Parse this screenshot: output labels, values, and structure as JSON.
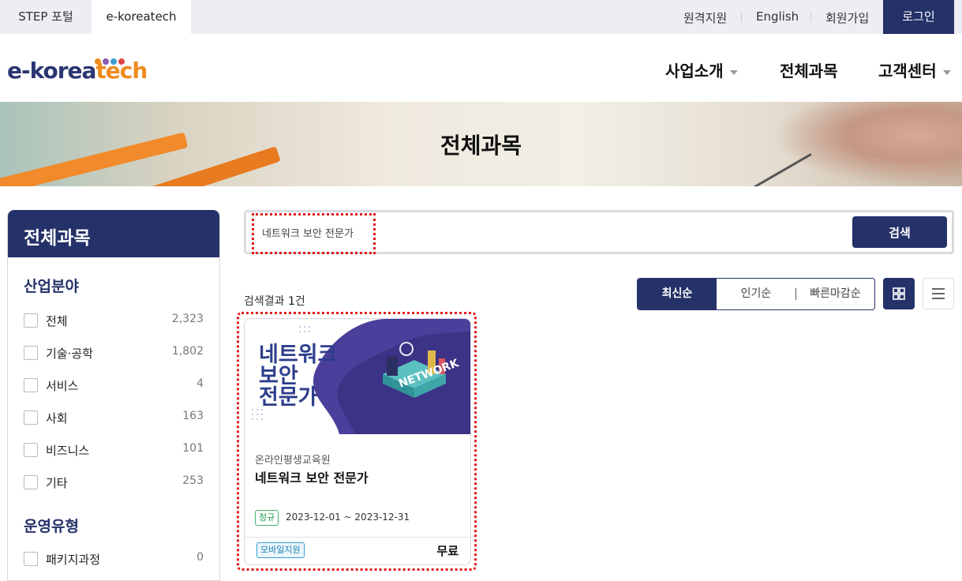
{
  "topbar": {
    "tabs": [
      "STEP 포털",
      "e-koreatech"
    ],
    "links": [
      "원격지원",
      "English",
      "회원가입"
    ],
    "login": "로그인"
  },
  "header": {
    "logo_part1": "e-korea",
    "logo_part2": "tech",
    "nav": [
      "사업소개",
      "전체과목",
      "고객센터"
    ]
  },
  "banner": {
    "title": "전체과목"
  },
  "sidebar": {
    "title": "전체과목",
    "section1": "산업분야",
    "industry": [
      {
        "label": "전체",
        "count": "2,323"
      },
      {
        "label": "기술·공학",
        "count": "1,802"
      },
      {
        "label": "서비스",
        "count": "4"
      },
      {
        "label": "사회",
        "count": "163"
      },
      {
        "label": "비즈니스",
        "count": "101"
      },
      {
        "label": "기타",
        "count": "253"
      }
    ],
    "section2": "운영유형",
    "operation": [
      {
        "label": "패키지과정",
        "count": "0"
      }
    ]
  },
  "search": {
    "value": "네트워크 보안 전문가",
    "button": "검색"
  },
  "results": {
    "prefix": "검색결과 ",
    "count": "1",
    "suffix": "건"
  },
  "sort": {
    "options": [
      "최신순",
      "인기순",
      "빠른마감순"
    ],
    "active": "최신순"
  },
  "card": {
    "thumb_line1": "네트워크",
    "thumb_line2": "보안",
    "thumb_line3": "전문가",
    "thumb_word": "NETWORK",
    "org": "온라인평생교육원",
    "title": "네트워크 보안 전문가",
    "type_badge": "정규",
    "period": "2023-12-01 ~ 2023-12-31",
    "mobile_badge": "모바일지원",
    "price": "무료"
  },
  "colors": {
    "primary": "#253269",
    "highlight": "#e01b1b",
    "logo_orange": "#f08a1d",
    "thumb_purple": "#4a3f9a"
  }
}
